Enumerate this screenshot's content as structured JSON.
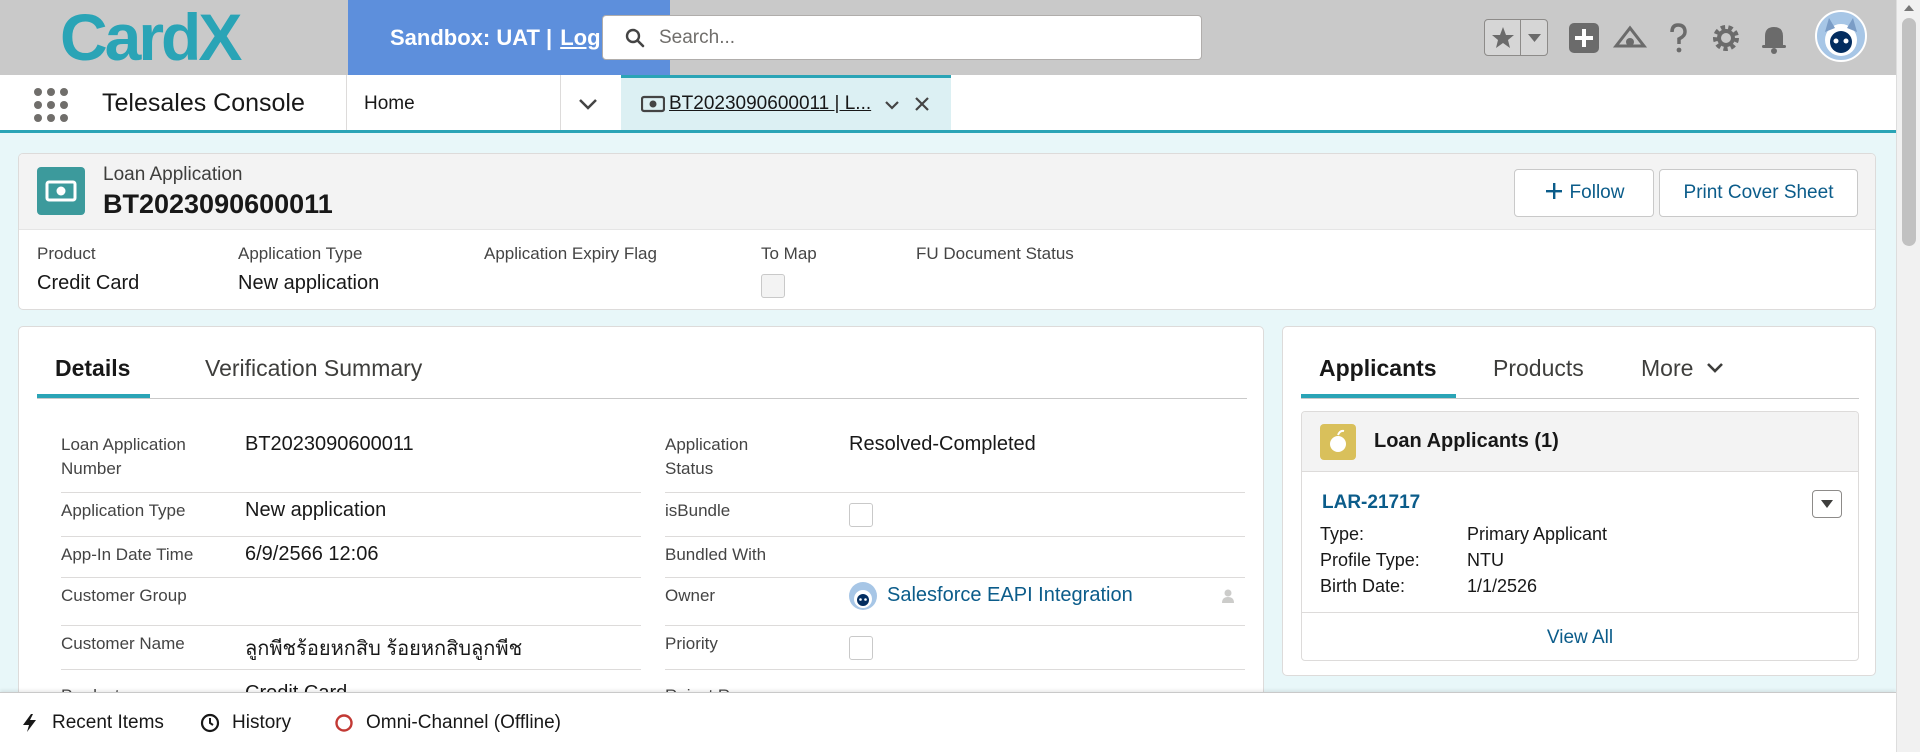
{
  "header": {
    "logo_text": "CardX",
    "sandbox_label": "Sandbox: UAT |",
    "logout_label": "Log",
    "search_placeholder": "Search..."
  },
  "nav": {
    "app_name": "Telesales Console",
    "home_label": "Home",
    "active_tab_label": "BT2023090600011 | L..."
  },
  "record": {
    "object_type": "Loan Application",
    "title": "BT2023090600011",
    "follow_label": "Follow",
    "print_label": "Print Cover Sheet",
    "highlights": [
      {
        "label": "Product",
        "value": "Credit Card"
      },
      {
        "label": "Application Type",
        "value": "New application"
      },
      {
        "label": "Application Expiry Flag",
        "value": ""
      },
      {
        "label": "To Map",
        "value": ""
      },
      {
        "label": "FU Document Status",
        "value": ""
      }
    ]
  },
  "details": {
    "tabs": [
      "Details",
      "Verification Summary"
    ],
    "left": [
      {
        "label": "Loan Application Number",
        "value": "BT2023090600011"
      },
      {
        "label": "Application Type",
        "value": "New application"
      },
      {
        "label": "App-In Date Time",
        "value": "6/9/2566 12:06"
      },
      {
        "label": "Customer Group",
        "value": ""
      },
      {
        "label": "Customer Name",
        "value": "ลูกพีชร้อยหกสิบ ร้อยหกสิบลูกพีช"
      },
      {
        "label": "Product",
        "value": "Credit Card"
      }
    ],
    "right": [
      {
        "label": "Application Status",
        "value": "Resolved-Completed"
      },
      {
        "label": "isBundle",
        "value": ""
      },
      {
        "label": "Bundled With",
        "value": ""
      },
      {
        "label": "Owner",
        "value": "Salesforce EAPI Integration"
      },
      {
        "label": "Priority",
        "value": ""
      },
      {
        "label": "Reject Reason",
        "value": ""
      }
    ]
  },
  "related": {
    "tabs": [
      "Applicants",
      "Products",
      "More"
    ],
    "list_title": "Loan Applicants (1)",
    "record_link": "LAR-21717",
    "fields": [
      {
        "label": "Type:",
        "value": "Primary Applicant"
      },
      {
        "label": "Profile Type:",
        "value": "NTU"
      },
      {
        "label": "Birth Date:",
        "value": "1/1/2526"
      }
    ],
    "view_all": "View All"
  },
  "utility": {
    "recent_items": "Recent Items",
    "history": "History",
    "omni_channel": "Omni-Channel (Offline)"
  },
  "colors": {
    "brand_teal": "#2aa4b6",
    "sandbox_blue": "#5d8fdc",
    "link": "#0b5c8a",
    "record_icon": "#3c9a9c",
    "omni_offline": "#c23934"
  }
}
